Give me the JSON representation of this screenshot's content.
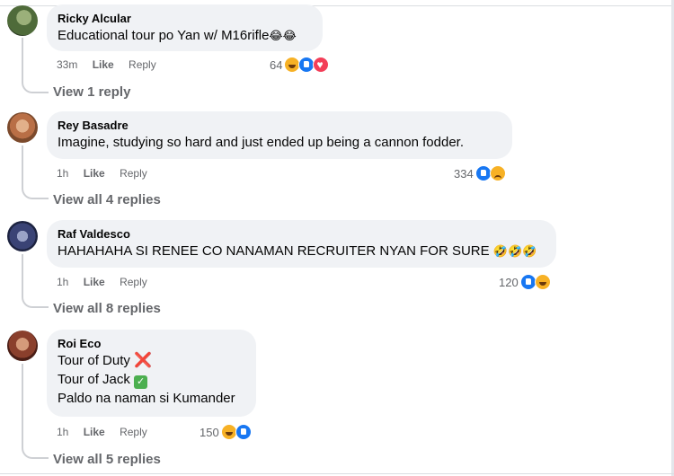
{
  "comments": [
    {
      "author": "Ricky Alcular",
      "lines": [
        "Educational tour po Yan w/ M16rifle"
      ],
      "emoji_suffix": "😂😂",
      "time": "33m",
      "like": "Like",
      "reply": "Reply",
      "reaction_count": "64",
      "reaction_icons": [
        "haha-icon",
        "like-icon",
        "love-icon"
      ],
      "replies": "View 1 reply"
    },
    {
      "author": "Rey Basadre",
      "lines": [
        "Imagine, studying so hard and just ended up being a cannon fodder."
      ],
      "time": "1h",
      "like": "Like",
      "reply": "Reply",
      "reaction_count": "334",
      "reaction_icons": [
        "like-icon",
        "sad-icon"
      ],
      "replies": "View all 4 replies"
    },
    {
      "author": "Raf Valdesco",
      "lines": [
        "HAHAHAHA SI RENEE CO NANAMAN RECRUITER NYAN FOR SURE"
      ],
      "emoji_suffix": "🤣🤣🤣",
      "time": "1h",
      "like": "Like",
      "reply": "Reply",
      "reaction_count": "120",
      "reaction_icons": [
        "like-icon",
        "haha-icon"
      ],
      "replies": "View all 8 replies"
    },
    {
      "author": "Roi Eco",
      "lines": [
        "Tour of Duty",
        "Tour of Jack",
        "Paldo na naman si Kumander"
      ],
      "line_marks": [
        "❌",
        "✅",
        ""
      ],
      "time": "1h",
      "like": "Like",
      "reply": "Reply",
      "reaction_count": "150",
      "reaction_icons": [
        "haha-icon",
        "like-icon"
      ],
      "replies": "View all 5 replies"
    }
  ],
  "colors": {
    "bubble": "#f0f2f5",
    "meta_text": "#65676b",
    "like_blue": "#1877f2",
    "love_red": "#f33e58",
    "haha_yellow": "#f7b125"
  }
}
